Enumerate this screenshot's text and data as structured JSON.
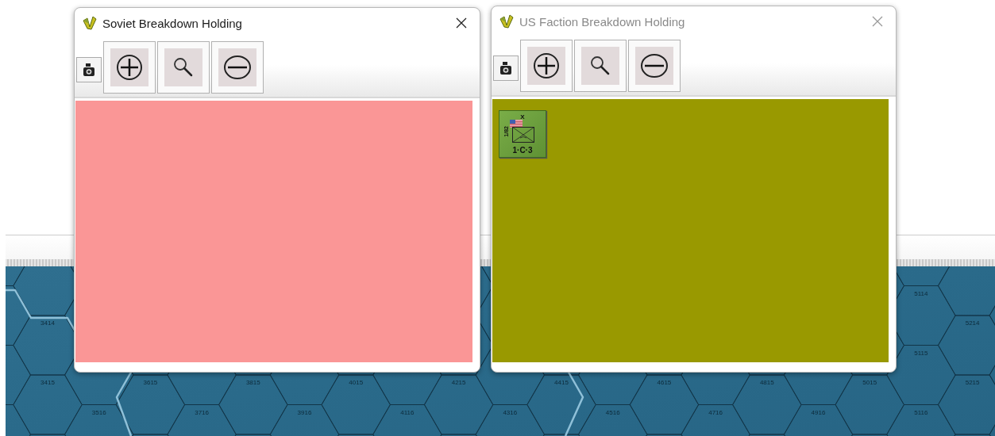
{
  "windows": [
    {
      "title": "Soviet Breakdown Holding",
      "active": true,
      "color": "#fa9696"
    },
    {
      "title": "US Faction Breakdown Holding",
      "active": false,
      "color": "#999900",
      "counters": [
        {
          "size": "X",
          "unit": "1/82",
          "values": "1·C·3"
        }
      ]
    }
  ],
  "map": {
    "hex_labels": [
      "3414",
      "3415",
      "3516",
      "3615",
      "3716",
      "3815",
      "3916",
      "4015",
      "4116",
      "4215",
      "4316",
      "4415",
      "4516",
      "4615",
      "4716",
      "4815",
      "4916",
      "5015",
      "5114",
      "5115",
      "5116",
      "5214",
      "5215"
    ]
  }
}
